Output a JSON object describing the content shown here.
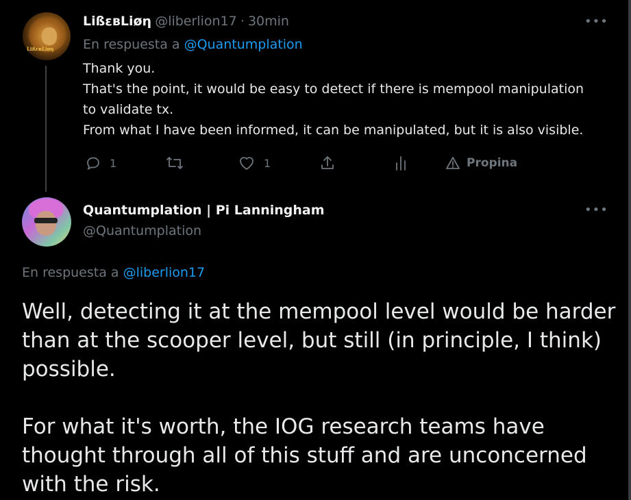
{
  "reply_tweet": {
    "display_name": "LißεвLiøη",
    "handle": "@liberlion17",
    "separator": "·",
    "time": "30min",
    "reply_prefix": "En respuesta a",
    "reply_mention": "@Quantumplation",
    "lines": [
      "Thank you.",
      "That's the point, it would be easy to detect if there is mempool manipulation",
      "to validate tx.",
      "From what I have been informed, it can be manipulated, but it is also visible."
    ],
    "actions": {
      "reply_count": "1",
      "retweet_count": "",
      "like_count": "1",
      "promote_label": "Propina"
    },
    "icons": [
      "reply-icon",
      "retweet-icon",
      "like-icon",
      "share-icon",
      "analytics-icon",
      "promote-icon",
      "more-icon"
    ]
  },
  "main_tweet": {
    "display_name": "Quantumplation | Pi Lanningham",
    "handle": "@Quantumplation",
    "reply_prefix": "En respuesta a",
    "reply_mention": "@liberlion17",
    "lines": [
      "Well, detecting it at the mempool level would be harder",
      "than at the scooper level, but still (in principle, I think)",
      "possible.",
      "",
      "For what it's worth, the IOG research teams have",
      "thought through all of this stuff and are unconcerned",
      "with the risk."
    ]
  },
  "colors": {
    "background": "#000000",
    "text": "#e7e9ea",
    "secondary": "#6e767d",
    "link": "#1d9bf0"
  }
}
